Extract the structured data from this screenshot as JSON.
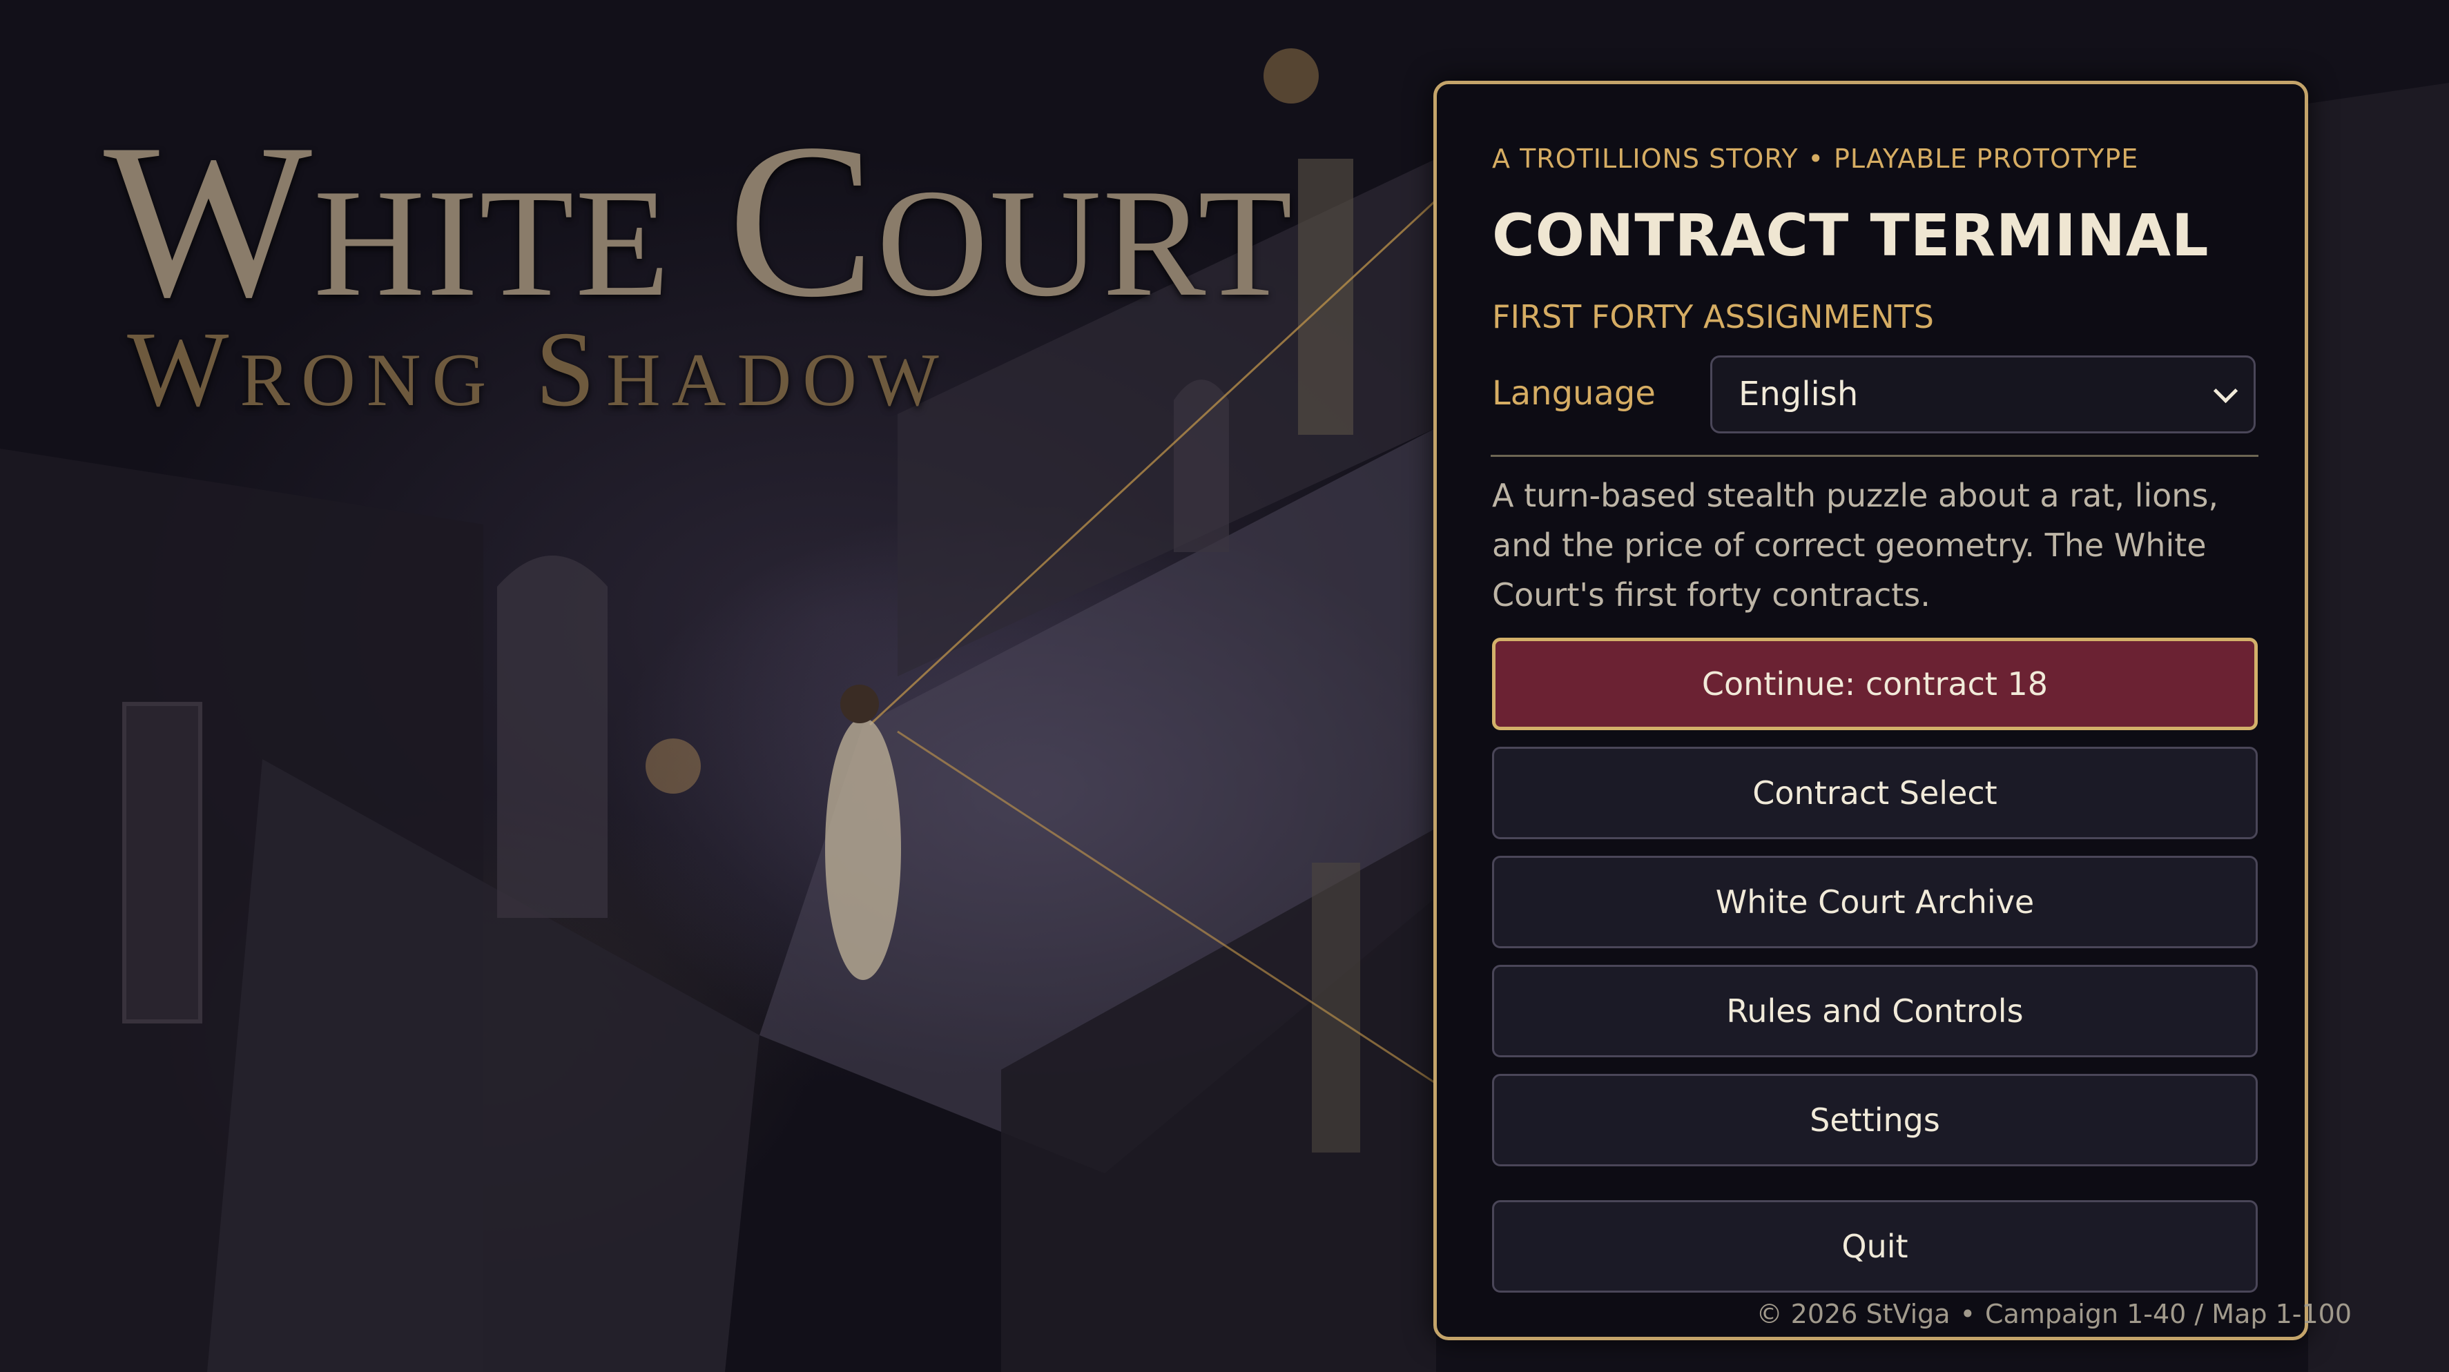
{
  "title_art": {
    "line1": "White Court",
    "line2": "Wrong Shadow"
  },
  "panel": {
    "eyebrow_left": "A TROTILLIONS STORY",
    "eyebrow_sep": "•",
    "eyebrow_right": "PLAYABLE PROTOTYPE",
    "title": "CONTRACT TERMINAL",
    "subtitle": "FIRST FORTY ASSIGNMENTS",
    "language_label": "Language",
    "language_value": "English",
    "description": "A turn-based stealth puzzle about a rat, lions, and the price of correct geometry. The White Court's first forty contracts."
  },
  "menu": {
    "continue": "Continue: contract 18",
    "contract_select": "Contract Select",
    "archive": "White Court Archive",
    "rules": "Rules and Controls",
    "settings": "Settings",
    "quit": "Quit"
  },
  "footer": {
    "copyright": "© 2026 StViga",
    "sep": "•",
    "info": "Campaign 1-40 / Map 1-100"
  },
  "colors": {
    "accent_gold": "#d6ad63",
    "primary_button": "#6b2233",
    "panel_border": "#c4a46a"
  }
}
